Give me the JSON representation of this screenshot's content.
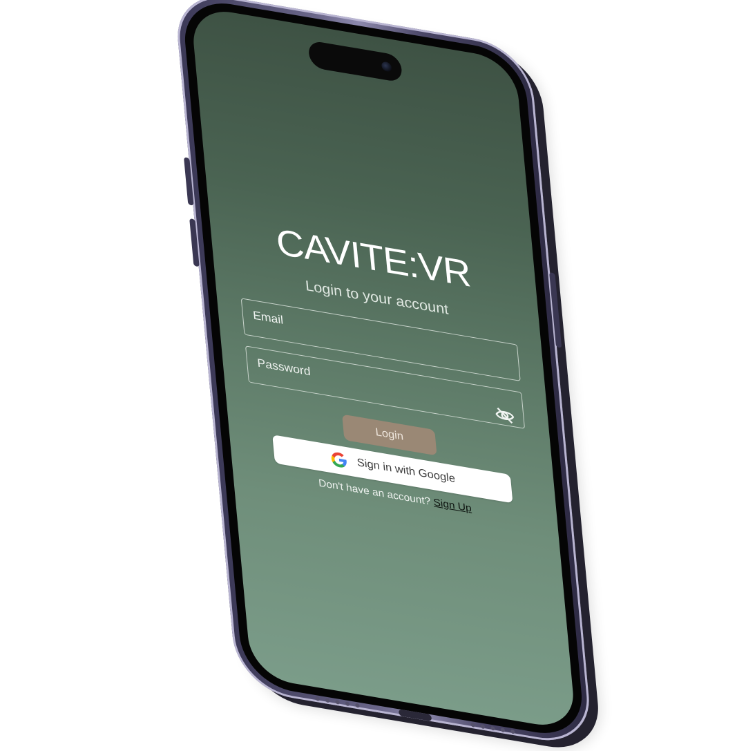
{
  "app": {
    "title": "CAVITE:VR",
    "subtitle": "Login to your account"
  },
  "form": {
    "email_label": "Email",
    "password_label": "Password",
    "password_toggle_icon": "eye-off-icon",
    "login_label": "Login",
    "google_label": "Sign in with Google",
    "google_icon": "google-g-icon"
  },
  "signup": {
    "prompt": "Don't have an account?",
    "link": "Sign Up"
  },
  "colors": {
    "screen_top": "#3e5244",
    "screen_bottom": "#7b9c89",
    "login_button": "#9a8875",
    "phone_frame": "#5b5778"
  }
}
